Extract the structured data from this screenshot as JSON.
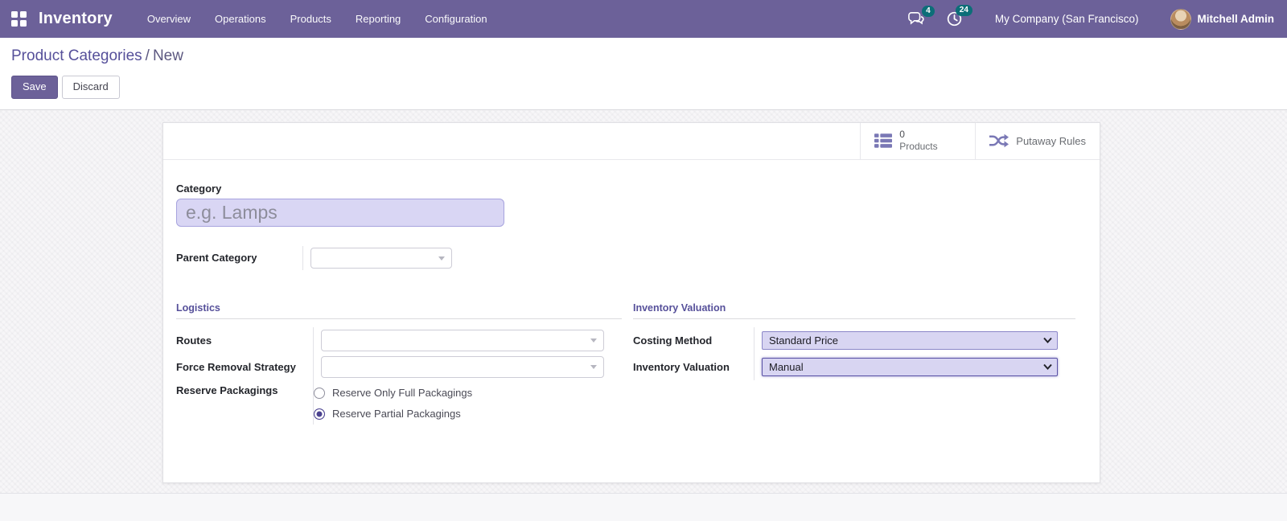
{
  "navbar": {
    "brand": "Inventory",
    "menus": [
      "Overview",
      "Operations",
      "Products",
      "Reporting",
      "Configuration"
    ],
    "messages_count": "4",
    "activities_count": "24",
    "company": "My Company (San Francisco)",
    "user": "Mitchell Admin"
  },
  "control_panel": {
    "breadcrumb_parent": "Product Categories",
    "breadcrumb_separator": "/",
    "breadcrumb_current": "New",
    "save_label": "Save",
    "discard_label": "Discard"
  },
  "button_box": {
    "products_count": "0",
    "products_label": "Products",
    "putaway_label": "Putaway Rules"
  },
  "form": {
    "category_label": "Category",
    "category_placeholder": "e.g. Lamps",
    "parent_category_label": "Parent Category",
    "logistics": {
      "title": "Logistics",
      "routes_label": "Routes",
      "force_removal_label": "Force Removal Strategy",
      "reserve_label": "Reserve Packagings",
      "radio_full": "Reserve Only Full Packagings",
      "radio_partial": "Reserve Partial Packagings"
    },
    "valuation": {
      "title": "Inventory Valuation",
      "costing_label": "Costing Method",
      "costing_value": "Standard Price",
      "valuation_label": "Inventory Valuation",
      "valuation_value": "Manual"
    }
  },
  "colors": {
    "navbar_purple": "#6c6199",
    "badge_teal": "#0c6e78",
    "lavender_field": "#d8d5f2",
    "accent_icon": "#7a78b5"
  }
}
